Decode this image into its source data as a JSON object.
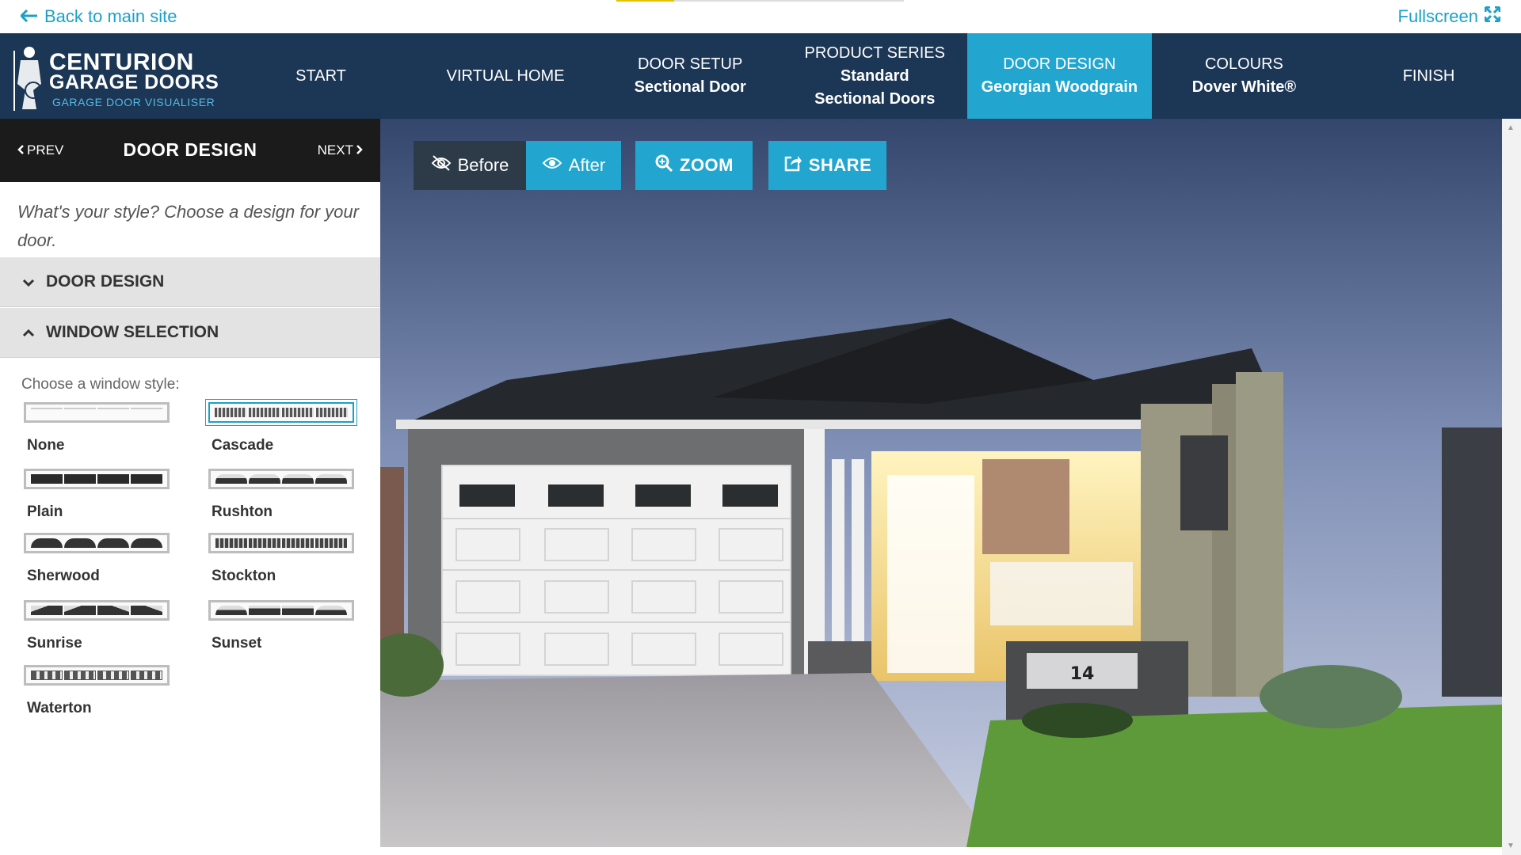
{
  "topbar": {
    "back_label": "Back to main site",
    "fullscreen_label": "Fullscreen",
    "progress_fraction": 0.2
  },
  "logo": {
    "line1": "CENTURION",
    "line2": "GARAGE DOORS",
    "line3": "GARAGE DOOR VISUALISER"
  },
  "nav": [
    {
      "title": "START",
      "sub": ""
    },
    {
      "title": "VIRTUAL HOME",
      "sub": ""
    },
    {
      "title": "DOOR SETUP",
      "sub": "Sectional Door"
    },
    {
      "title": "PRODUCT SERIES",
      "sub": "Standard Sectional Doors"
    },
    {
      "title": "DOOR DESIGN",
      "sub": "Georgian Woodgrain"
    },
    {
      "title": "COLOURS",
      "sub": "Dover White®"
    },
    {
      "title": "FINISH",
      "sub": ""
    }
  ],
  "active_nav_index": 4,
  "sidebar": {
    "prev_label": "PREV",
    "title": "DOOR DESIGN",
    "next_label": "NEXT",
    "prompt": "What's your style? Choose a design for your door.",
    "accordion_door_design": "DOOR DESIGN",
    "accordion_window_selection": "WINDOW SELECTION",
    "choose_window_label": "Choose a window style:",
    "windows": [
      {
        "name": "None",
        "style": "none"
      },
      {
        "name": "Cascade",
        "style": "cascade"
      },
      {
        "name": "Plain",
        "style": "plain"
      },
      {
        "name": "Rushton",
        "style": "rushton"
      },
      {
        "name": "Sherwood",
        "style": "sherwood"
      },
      {
        "name": "Stockton",
        "style": "stockton"
      },
      {
        "name": "Sunrise",
        "style": "sunrise"
      },
      {
        "name": "Sunset",
        "style": "sunset"
      },
      {
        "name": "Waterton",
        "style": "waterton"
      }
    ],
    "selected_window": "Cascade"
  },
  "toolbar": {
    "before_label": "Before",
    "after_label": "After",
    "zoom_label": "ZOOM",
    "share_label": "SHARE"
  },
  "house": {
    "house_number": "14"
  },
  "colors": {
    "nav_bg": "#1c3655",
    "accent": "#22a6cf",
    "link": "#1ba1c8",
    "sidebar_head": "#1b1b1b",
    "before_btn": "#2d3a48",
    "door": "#f2f2f2"
  }
}
